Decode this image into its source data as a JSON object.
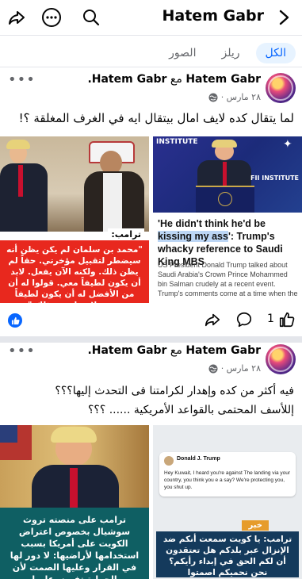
{
  "topbar": {
    "title": "Hatem Gabr",
    "share_icon": "share-icon",
    "more_icon": "more-icon",
    "search_icon": "search-icon",
    "forward_icon": "chevron-right-icon"
  },
  "tabs": [
    {
      "label": "الكل",
      "active": true
    },
    {
      "label": "ريلز",
      "active": false
    },
    {
      "label": "الصور",
      "active": false
    }
  ],
  "posts": [
    {
      "author": "Hatem Gabr",
      "with_word": "مع",
      "tagged": "Hatem Gabr.",
      "date": "٢٨ مارس ·",
      "text": "لما يتقال كده لايف امال بيتقال ايه في الغرف المغلقة ؟!",
      "left_image": {
        "label": "ترامب:",
        "quote": "\"محمد بن سلمان لم يكن يظن أنه سيضطر لتقبيل مؤخرتي. حقاً لم يظن ذلك. ولكنه الآن يفعل. لابد أن يكون لطيفاً معي. قولوا له أن من الأفضل له أن يكون لطيفاً معي. لا بد له من ذلك.\""
      },
      "right_image": {
        "brand": "INSTITUTE",
        "brand2": "FII INSTITUTE",
        "headline_part1": "'He didn't think he'd be ",
        "headline_highlight": "kissing my ass",
        "headline_part2": "': Trump's whacky reference to Saudi King MBS",
        "caption": "US President Donald Trump talked about Saudi Arabia's Crown Prince Mohammed bin Salman crudely at a recent event. Trump's comments come at a time when the US-Israel"
      },
      "reaction_count": "1"
    },
    {
      "author": "Hatem Gabr",
      "with_word": "مع",
      "tagged": "Hatem Gabr.",
      "date": "٢٨ مارس ·",
      "text_line1": "فيه أكثر من كده وإهدار لكرامتنا فى التحدث إليها؟؟؟",
      "text_line2": "إللأسف المحتمى بالقواعد الأمريكية ...... ؟؟؟",
      "left_image": {
        "caption": "ترامب على منصته تروث سوشيال بخصوص اعتراض الكويت على أمريكا بسبب استخدامها لأراضيها: لا دور لها في القرار وعليها الصمت لأن الحماية تفرض عليها"
      },
      "right_image": {
        "tweet_author": "Donald J. Trump",
        "tweet_text": "Hey Kuwait, I heard you're against The landing via your country, you think you e a say? We're protecting you, you shut up.",
        "news_tag": "خبر",
        "caption": "ترامب: يا كويت سمعت أنكم ضد الإنزال عبر بلدكم هل تعتقدون أن لكم الحق في إبداء رأيكم؟ نحن نحميكم اصمتوا"
      }
    }
  ],
  "colors": {
    "accent": "#0866ff",
    "muted": "#65676b",
    "separator": "#e4e6eb",
    "red_banner": "#e8281e",
    "teal_banner": "#0f5f63"
  }
}
